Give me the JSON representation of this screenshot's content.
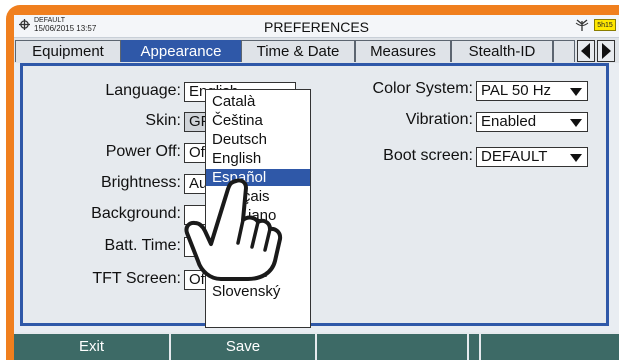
{
  "status_bar": {
    "profile": "DEFAULT",
    "datetime": "15/06/2015 13:57",
    "title": "PREFERENCES",
    "battery": "5h15"
  },
  "tabs": [
    {
      "label": "Equipment",
      "active": false
    },
    {
      "label": "Appearance",
      "active": true
    },
    {
      "label": "Time & Date",
      "active": false
    },
    {
      "label": "Measures",
      "active": false
    },
    {
      "label": "Stealth-ID",
      "active": false
    }
  ],
  "left_fields": {
    "language": {
      "label": "Language:",
      "value": "English"
    },
    "skin": {
      "label": "Skin:",
      "value": "GF"
    },
    "power_off": {
      "label": "Power Off:",
      "value": "Of"
    },
    "brightness": {
      "label": "Brightness:",
      "value": "Au"
    },
    "background": {
      "label": "Background:",
      "value": ""
    },
    "batt_time": {
      "label": "Batt. Time:",
      "value": ""
    },
    "tft_screen": {
      "label": "TFT Screen:",
      "value": "Of"
    }
  },
  "right_fields": {
    "color_system": {
      "label": "Color System:",
      "value": "PAL 50 Hz"
    },
    "vibration": {
      "label": "Vibration:",
      "value": "Enabled"
    },
    "boot_screen": {
      "label": "Boot screen:",
      "value": "DEFAULT"
    }
  },
  "language_dropdown": {
    "options": [
      "Català",
      "Čeština",
      "Deutsch",
      "English",
      "Español",
      "Français",
      "Italiano",
      "Norsk",
      "Polski",
      "Русский",
      "Slovenský"
    ],
    "visible_text": [
      "Català",
      "Čeština",
      "Deutsch",
      "English",
      "Español",
      "Fr",
      "ançais",
      "iano",
      "sk",
      "olski",
      "Русский",
      "Slovenský"
    ],
    "selected": "Español"
  },
  "function_keys": [
    "Exit",
    "Save",
    "",
    "",
    ""
  ],
  "colors": {
    "bezel": "#f07f1e",
    "accent": "#2f58a8",
    "function_key": "#3d6a66",
    "battery": "#ffe800"
  },
  "icons": [
    "settings-icon",
    "antenna-icon",
    "battery-icon",
    "arrow-left-icon",
    "arrow-right-icon",
    "dropdown-caret-icon",
    "pointing-hand-icon"
  ]
}
